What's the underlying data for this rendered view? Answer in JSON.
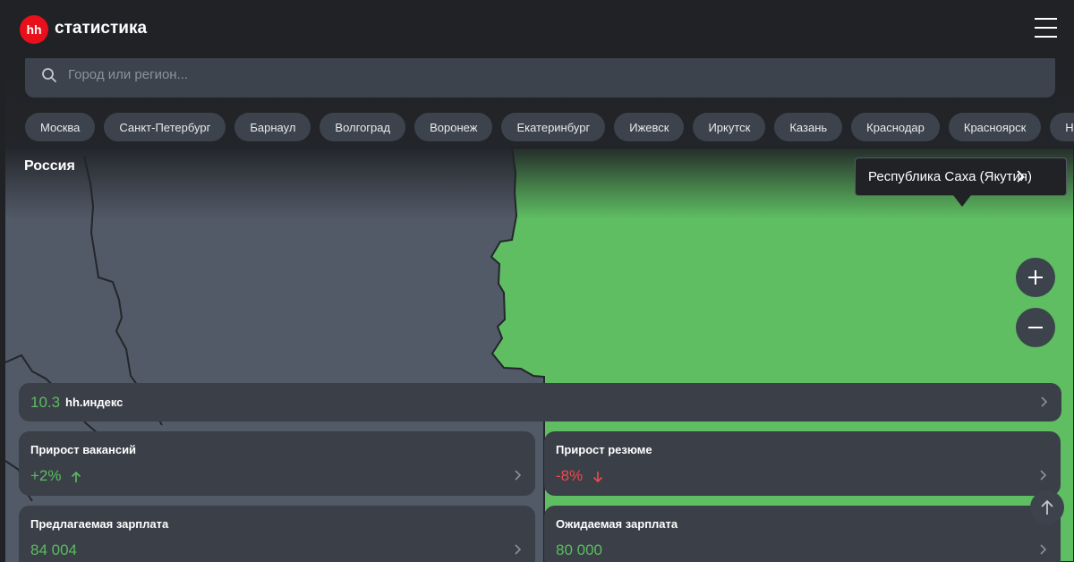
{
  "header": {
    "logo_text": "hh",
    "title": "статистика",
    "menu_icon": "hamburger-menu-icon"
  },
  "search": {
    "placeholder": "Город или регион..."
  },
  "cities": [
    "Москва",
    "Санкт-Петербург",
    "Барнаул",
    "Волгоград",
    "Воронеж",
    "Екатеринбург",
    "Ижевск",
    "Иркутск",
    "Казань",
    "Краснодар",
    "Красноярск",
    "Ни"
  ],
  "map": {
    "region_title": "Россия",
    "tooltip_region": "Республика Саха (Якутия)",
    "highlight_color": "#5fbe62",
    "base_color": "#525a67"
  },
  "index_card": {
    "value": "10.3",
    "label": "hh.индекс"
  },
  "vacancies_growth": {
    "title": "Прирост вакансий",
    "value": "+2%"
  },
  "resume_growth": {
    "title": "Прирост резюме",
    "value": "-8%"
  },
  "offered_salary": {
    "title": "Предлагаемая зарплата",
    "value": "84 004"
  },
  "expected_salary": {
    "title": "Ожидаемая зарплата",
    "value": "80 000"
  },
  "colors": {
    "positive": "#5bbd5f",
    "negative": "#f04a4a",
    "brand": "#e8101a"
  }
}
